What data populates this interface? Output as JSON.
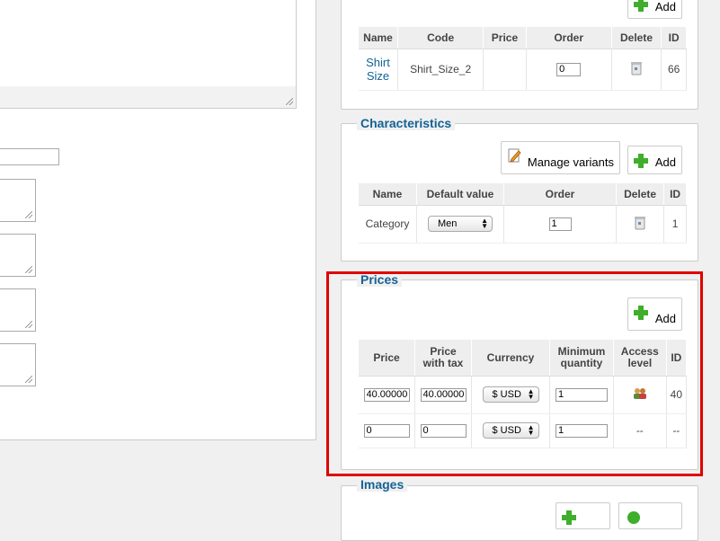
{
  "products_section": {
    "add_label": "Add",
    "headers": [
      "Name",
      "Code",
      "Price",
      "Order",
      "Delete",
      "ID"
    ],
    "row": {
      "name": "Shirt Size",
      "code": "Shirt_Size_2",
      "price": "",
      "order": "0",
      "id": "66"
    }
  },
  "characteristics": {
    "legend": "Characteristics",
    "manage_label": "Manage variants",
    "add_label": "Add",
    "headers": [
      "Name",
      "Default value",
      "Order",
      "Delete",
      "ID"
    ],
    "row": {
      "name": "Category",
      "default_value": "Men",
      "order": "1",
      "id": "1"
    }
  },
  "prices": {
    "legend": "Prices",
    "add_label": "Add",
    "headers": [
      "Price",
      "Price with tax",
      "Currency",
      "Minimum quantity",
      "Access level",
      "ID"
    ],
    "rows": [
      {
        "price": "40.00000",
        "price_with_tax": "40.00000",
        "currency": "$ USD",
        "min_qty": "1",
        "access_icon": "users-icon",
        "id": "40"
      },
      {
        "price": "0",
        "price_with_tax": "0",
        "currency": "$ USD",
        "min_qty": "1",
        "access_text": "--",
        "id": "--"
      }
    ]
  },
  "images": {
    "legend": "Images"
  },
  "colors": {
    "highlight": "#e00000",
    "legend": "#146295",
    "plus": "#3fae2a"
  }
}
